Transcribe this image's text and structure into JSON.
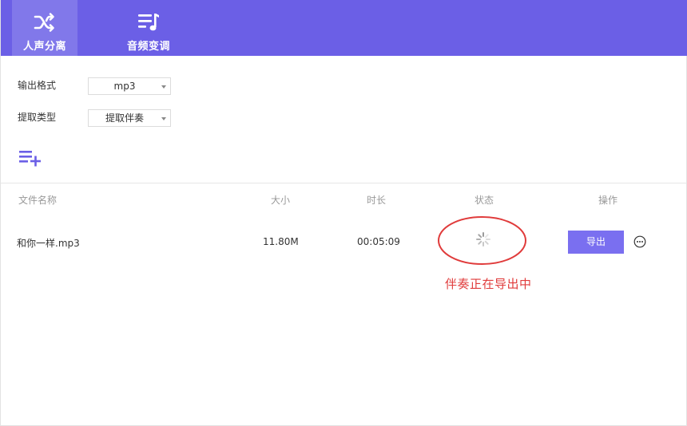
{
  "tabs": [
    {
      "label": "人声分离",
      "icon": "shuffle-icon",
      "active": true
    },
    {
      "label": "音频变调",
      "icon": "music-list-icon",
      "active": false
    }
  ],
  "colors": {
    "accent": "#6b5fe6",
    "tab_active": "#8178ea",
    "button": "#7a6ff0",
    "annotation": "#e03b3b"
  },
  "form": {
    "output_format": {
      "label": "输出格式",
      "value": "mp3"
    },
    "extract_type": {
      "label": "提取类型",
      "value": "提取伴奏"
    }
  },
  "table": {
    "headers": {
      "name": "文件名称",
      "size": "大小",
      "duration": "时长",
      "status": "状态",
      "action": "操作"
    },
    "rows": [
      {
        "name": "和你一样.mp3",
        "size": "11.80M",
        "duration": "00:05:09",
        "status_icon": "loading-spinner-icon",
        "action_label": "导出"
      }
    ]
  },
  "annotation": {
    "text": "伴奏正在导出中"
  }
}
